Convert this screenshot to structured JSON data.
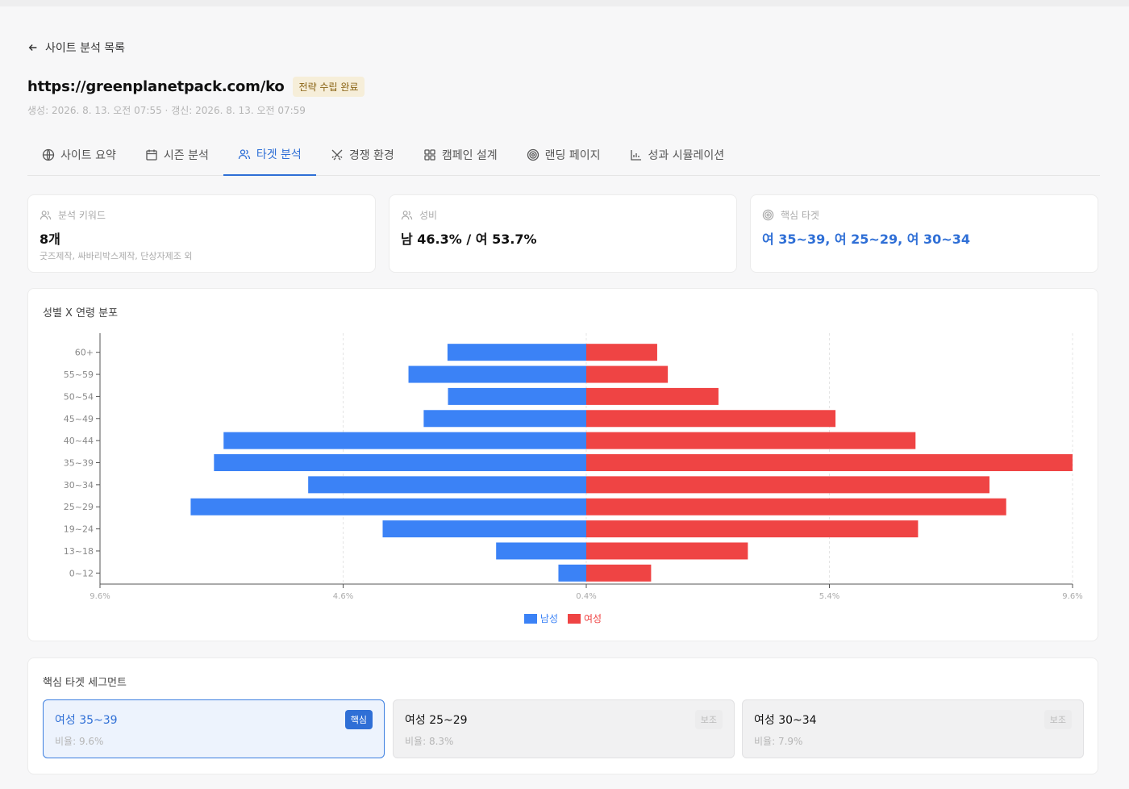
{
  "nav": {
    "back_label": "사이트 분석 목록"
  },
  "header": {
    "url": "https://greenplanetpack.com/ko",
    "status": "전략 수립 완료",
    "meta": "생성: 2026. 8. 13. 오전 07:55 · 갱신: 2026. 8. 13. 오전 07:59"
  },
  "tabs": [
    {
      "label": "사이트 요약",
      "icon": "globe-icon"
    },
    {
      "label": "시즌 분석",
      "icon": "calendar-icon"
    },
    {
      "label": "타겟 분석",
      "icon": "users-icon",
      "active": true
    },
    {
      "label": "경쟁 환경",
      "icon": "swords-icon"
    },
    {
      "label": "캠페인 설계",
      "icon": "grid-icon"
    },
    {
      "label": "랜딩 페이지",
      "icon": "target-icon"
    },
    {
      "label": "성과 시뮬레이션",
      "icon": "bar-chart-icon"
    }
  ],
  "stats": {
    "keywords": {
      "label": "분석 키워드",
      "value": "8개",
      "sub": "굿즈제작, 싸바리박스제작, 단상자제조 외"
    },
    "gender": {
      "label": "성비",
      "value": "남 46.3% / 여 53.7%"
    },
    "core_target": {
      "label": "핵심 타겟",
      "value": "여 35~39, 여 25~29, 여 30~34"
    }
  },
  "chart": {
    "title": "성별 X 연령 분포",
    "legend": [
      "남성",
      "여성"
    ]
  },
  "chart_data": {
    "type": "bar",
    "orientation": "horizontal",
    "layout": "population-pyramid",
    "categories": [
      "60+",
      "55~59",
      "50~54",
      "45~49",
      "40~44",
      "35~39",
      "30~34",
      "25~29",
      "19~24",
      "13~18",
      "0~12"
    ],
    "x_ticks": [
      "9.6%",
      "4.6%",
      "0.4%",
      "5.4%",
      "9.6%"
    ],
    "x_range": [
      -9.6,
      9.6
    ],
    "center": 0,
    "grid": "vertical dashed",
    "legend_position": "bottom",
    "colors": {
      "male": "#3b82f6",
      "female": "#ef4444"
    },
    "series": [
      {
        "name": "남성",
        "values": [
          2.74,
          3.51,
          2.73,
          3.21,
          7.16,
          7.35,
          5.49,
          7.81,
          4.02,
          1.78,
          0.55
        ]
      },
      {
        "name": "여성",
        "values": [
          1.4,
          1.61,
          2.61,
          4.92,
          6.5,
          9.6,
          7.96,
          8.29,
          6.55,
          3.19,
          1.28
        ]
      }
    ]
  },
  "segments": {
    "title": "핵심 타겟 세그먼트",
    "items": [
      {
        "name": "여성 35~39",
        "ratio": "비율: 9.6%",
        "tag": "핵심",
        "primary": true
      },
      {
        "name": "여성 25~29",
        "ratio": "비율: 8.3%",
        "tag": "보조",
        "primary": false
      },
      {
        "name": "여성 30~34",
        "ratio": "비율: 7.9%",
        "tag": "보조",
        "primary": false
      }
    ]
  }
}
